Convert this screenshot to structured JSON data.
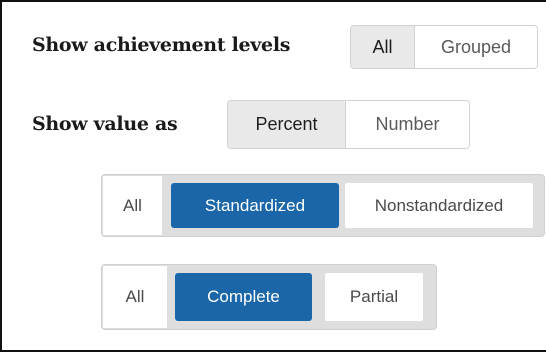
{
  "achievement": {
    "label": "Show achievement levels",
    "options": [
      "All",
      "Grouped"
    ],
    "selected": "All"
  },
  "value_as": {
    "label": "Show value as",
    "options": [
      "Percent",
      "Number"
    ],
    "selected": "Percent"
  },
  "standardization": {
    "options": [
      "All",
      "Standardized",
      "Nonstandardized"
    ],
    "selected": "Standardized"
  },
  "completeness": {
    "options": [
      "All",
      "Complete",
      "Partial"
    ],
    "selected": "Complete"
  },
  "colors": {
    "active_blue": "#1a66a8",
    "selected_gray": "#e9e9e9",
    "group_bg": "#dedede"
  }
}
